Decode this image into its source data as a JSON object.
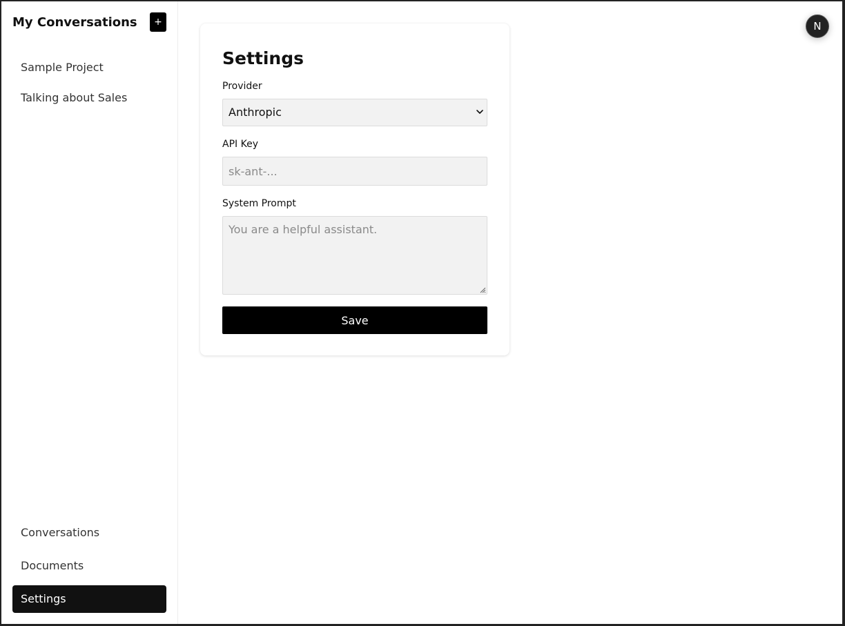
{
  "sidebar": {
    "title": "My Conversations",
    "new_button_label": "+",
    "conversations": [
      "Sample Project",
      "Talking about Sales"
    ],
    "nav": {
      "conversations": "Conversations",
      "documents": "Documents",
      "settings": "Settings"
    },
    "active_nav": "settings"
  },
  "settings": {
    "title": "Settings",
    "provider": {
      "label": "Provider",
      "value": "Anthropic"
    },
    "api_key": {
      "label": "API Key",
      "value": "",
      "placeholder": "sk-ant-..."
    },
    "system_prompt": {
      "label": "System Prompt",
      "value": "",
      "placeholder": "You are a helpful assistant."
    },
    "save_label": "Save"
  },
  "avatar": {
    "initial": "N",
    "icon": "nextjs-logo-icon"
  },
  "colors": {
    "accent": "#000000",
    "field_bg": "#f2f2f2",
    "active_nav_bg": "#111111"
  }
}
